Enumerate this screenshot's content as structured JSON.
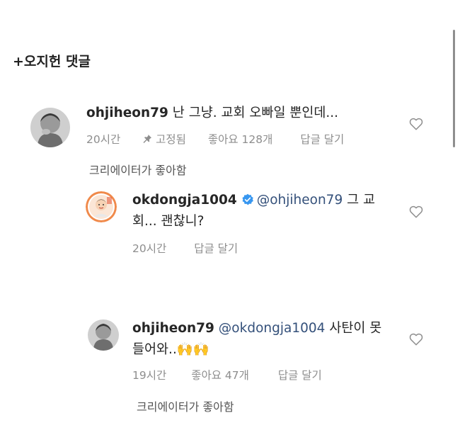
{
  "header": {
    "title": "+오지헌 댓글"
  },
  "comments": [
    {
      "username": "ohjiheon79",
      "text": "난 그냥.  교회 오빠일 뿐인데...",
      "time": "20시간",
      "pinned": "고정됨",
      "likes": "좋아요 128개",
      "reply": "답글 달기",
      "creator_liked": "크리에이터가 좋아함"
    },
    {
      "username": "okdongja1004",
      "mention": "@ohjiheon79",
      "text_line1": "그 교",
      "text_line2": "회... 괜찮니?",
      "time": "20시간",
      "reply": "답글 달기"
    },
    {
      "username": "ohjiheon79",
      "mention": "@okdongja1004",
      "text_line1": "사탄이 못",
      "text_line2": "들어와..",
      "emoji": "🙌🙌",
      "time": "19시간",
      "likes": "좋아요 47개",
      "reply": "답글 달기",
      "creator_liked": "크리에이터가 좋아함"
    }
  ],
  "colors": {
    "mention": "#34507a",
    "meta": "#8e8e8e",
    "verified": "#3897f0"
  },
  "icons": [
    "heart-outline-icon",
    "pin-icon",
    "verified-badge-icon"
  ]
}
